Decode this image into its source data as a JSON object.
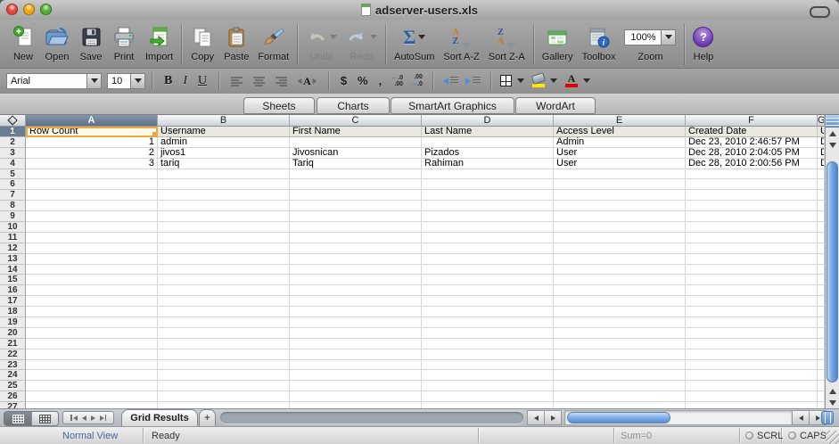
{
  "window": {
    "title": "adserver-users.xls"
  },
  "toolbar": {
    "items": [
      {
        "id": "new",
        "label": "New"
      },
      {
        "id": "open",
        "label": "Open"
      },
      {
        "id": "save",
        "label": "Save"
      },
      {
        "id": "print",
        "label": "Print"
      },
      {
        "id": "import",
        "label": "Import"
      },
      {
        "id": "copy",
        "label": "Copy"
      },
      {
        "id": "paste",
        "label": "Paste"
      },
      {
        "id": "format",
        "label": "Format"
      },
      {
        "id": "undo",
        "label": "Undo",
        "disabled": true
      },
      {
        "id": "redo",
        "label": "Redo",
        "disabled": true
      },
      {
        "id": "autosum",
        "label": "AutoSum"
      },
      {
        "id": "sort-az",
        "label": "Sort A-Z"
      },
      {
        "id": "sort-za",
        "label": "Sort Z-A"
      },
      {
        "id": "gallery",
        "label": "Gallery"
      },
      {
        "id": "toolbox",
        "label": "Toolbox"
      },
      {
        "id": "zoom",
        "label": "Zoom",
        "value": "100%"
      },
      {
        "id": "help",
        "label": "Help"
      }
    ]
  },
  "icons": {
    "sigma": "Σ",
    "sort_a": "A",
    "sort_z": "Z",
    "help_q": "?",
    "dec_dec_top": ".0",
    "dec_dec_bottom": ".00",
    "dec_inc_top": ".00",
    "dec_inc_bottom": ".0",
    "arrow_left": "←",
    "arrow_right": "→",
    "wrap_letter": "A",
    "font_color_letter": "A"
  },
  "format_bar": {
    "font": "Arial",
    "font_size": "10",
    "bold": "B",
    "italic": "I",
    "underline": "U",
    "currency": "$",
    "percent": "%",
    "comma": ","
  },
  "colors": {
    "selection_border": "#EFA63C",
    "fill_swatch": "#FFE800",
    "font_color_swatch": "#DD0000",
    "scrollbar_thumb": "#6FA3E0"
  },
  "gallery_tabs": [
    {
      "label": "Sheets"
    },
    {
      "label": "Charts"
    },
    {
      "label": "SmartArt Graphics"
    },
    {
      "label": "WordArt"
    }
  ],
  "grid": {
    "columns": [
      "A",
      "B",
      "C",
      "D",
      "E",
      "F",
      "G"
    ],
    "header_row": [
      "Row Count",
      "Username",
      "First Name",
      "Last Name",
      "Access Level",
      "Created Date",
      "U"
    ],
    "rows": [
      [
        "1",
        "admin",
        "",
        "",
        "Admin",
        "Dec 23, 2010 2:46:57 PM",
        "D"
      ],
      [
        "2",
        "jivos1",
        "Jivosnican",
        "Pizados",
        "User",
        "Dec 28, 2010 2:04:05 PM",
        "D"
      ],
      [
        "3",
        "tariq",
        "Tariq",
        "Rahiman",
        "User",
        "Dec 28, 2010 2:00:56 PM",
        "D"
      ]
    ],
    "visible_row_count": 27,
    "selected_cell": "A1",
    "selected_column": "A",
    "selected_row": "1"
  },
  "sheet_bar": {
    "tab_label": "Grid Results",
    "add_label": "+"
  },
  "status_bar": {
    "view_mode": "Normal View",
    "message": "Ready",
    "sum": "Sum=0",
    "indicators": [
      {
        "label": "SCRL"
      },
      {
        "label": "CAPS"
      }
    ]
  }
}
